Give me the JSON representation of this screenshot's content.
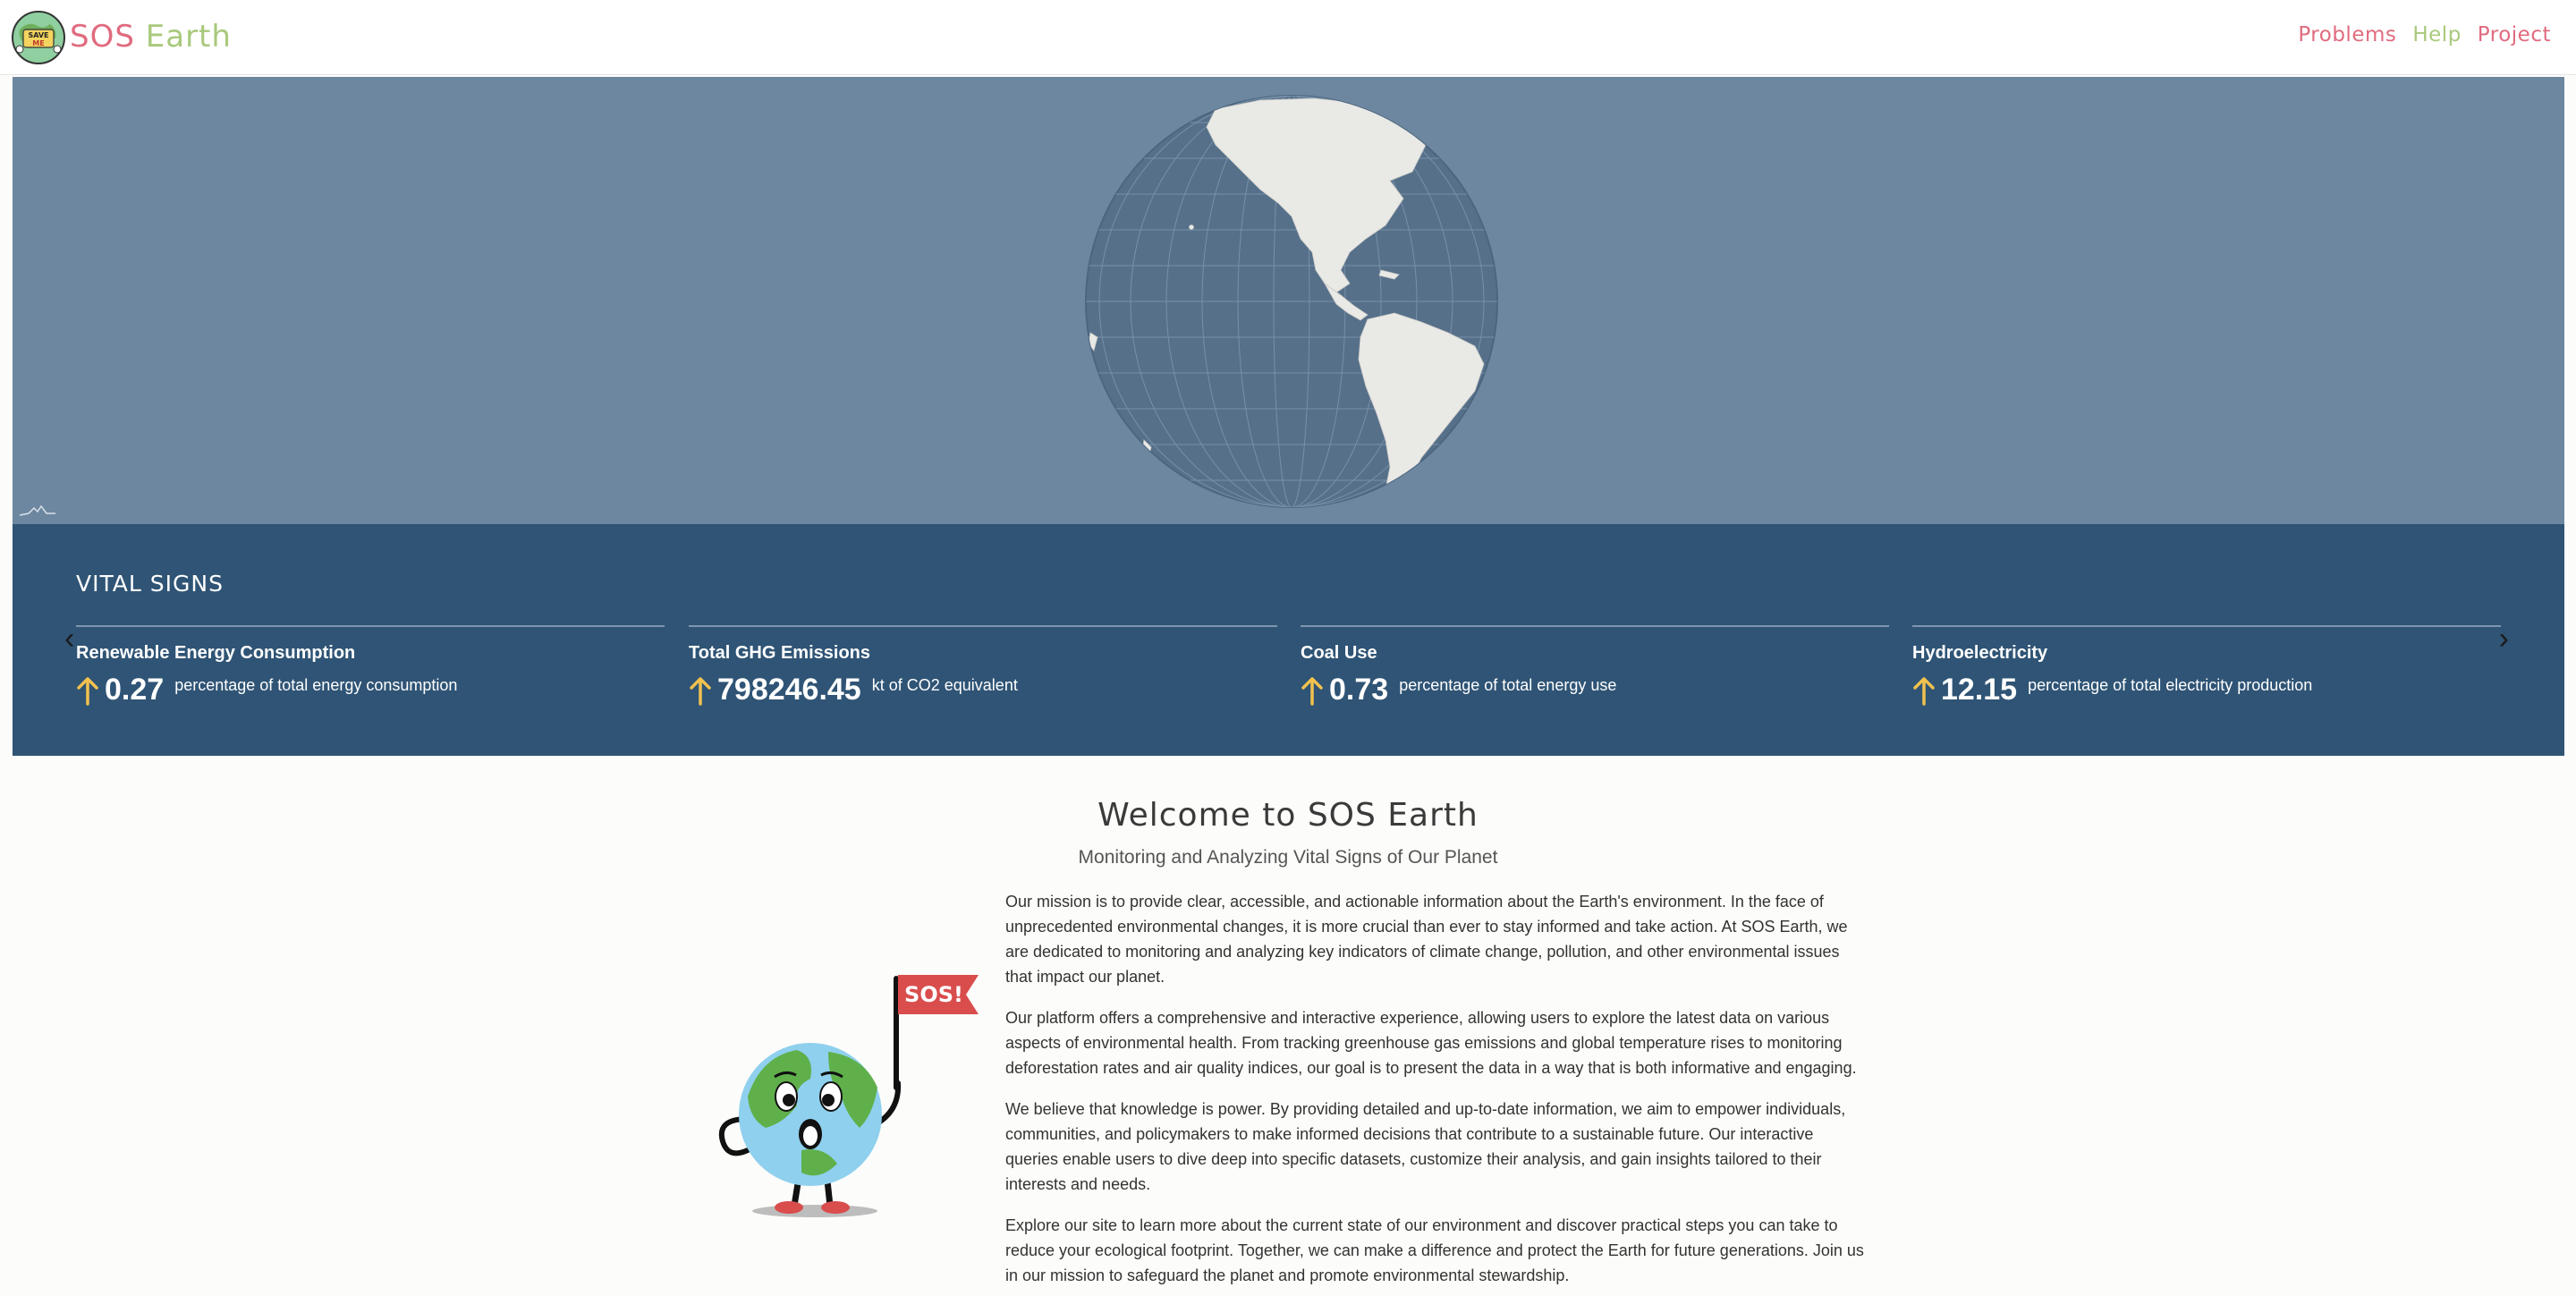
{
  "header": {
    "logo_icon": "save-me-earth-logo",
    "brand_part1": "SOS",
    "brand_part2": "Earth",
    "nav": [
      {
        "label": "Problems",
        "color": "#e06b7f"
      },
      {
        "label": "Help",
        "color": "#a9c97c"
      },
      {
        "label": "Project",
        "color": "#e06b7f"
      }
    ]
  },
  "hero": {
    "background": "#6e87a0",
    "globe_icon": "rotating-globe"
  },
  "vital_signs": {
    "title": "VITAL SIGNS",
    "prev_icon": "chevron-left-icon",
    "next_icon": "chevron-right-icon",
    "cards": [
      {
        "title": "Renewable Energy Consumption",
        "value": "0.27",
        "unit": "percentage of total energy consumption",
        "trend": "up"
      },
      {
        "title": "Total GHG Emissions",
        "value": "798246.45",
        "unit": "kt of CO2 equivalent",
        "trend": "up"
      },
      {
        "title": "Coal Use",
        "value": "0.73",
        "unit": "percentage of total energy use",
        "trend": "up"
      },
      {
        "title": "Hydroelectricity",
        "value": "12.15",
        "unit": "percentage of total electricity production",
        "trend": "up"
      }
    ]
  },
  "welcome": {
    "title": "Welcome to SOS Earth",
    "subtitle": "Monitoring and Analyzing Vital Signs of Our Planet",
    "mascot_flag": "SOS!",
    "paragraphs": [
      "Our mission is to provide clear, accessible, and actionable information about the Earth's environment. In the face of unprecedented environmental changes, it is more crucial than ever to stay informed and take action. At SOS Earth, we are dedicated to monitoring and analyzing key indicators of climate change, pollution, and other environmental issues that impact our planet.",
      "Our platform offers a comprehensive and interactive experience, allowing users to explore the latest data on various aspects of environmental health. From tracking greenhouse gas emissions and global temperature rises to monitoring deforestation rates and air quality indices, our goal is to present the data in a way that is both informative and engaging.",
      "We believe that knowledge is power. By providing detailed and up-to-date information, we aim to empower individuals, communities, and policymakers to make informed decisions that contribute to a sustainable future. Our interactive queries enable users to dive deep into specific datasets, customize their analysis, and gain insights tailored to their interests and needs.",
      "Explore our site to learn more about the current state of our environment and discover practical steps you can take to reduce your ecological footprint. Together, we can make a difference and protect the Earth for future generations. Join us in our mission to safeguard the planet and promote environmental stewardship."
    ]
  },
  "colors": {
    "accent_pink": "#e06b7f",
    "accent_green": "#a9c97c",
    "vital_bg": "#2f5475",
    "trend_up": "#f2c14e"
  }
}
